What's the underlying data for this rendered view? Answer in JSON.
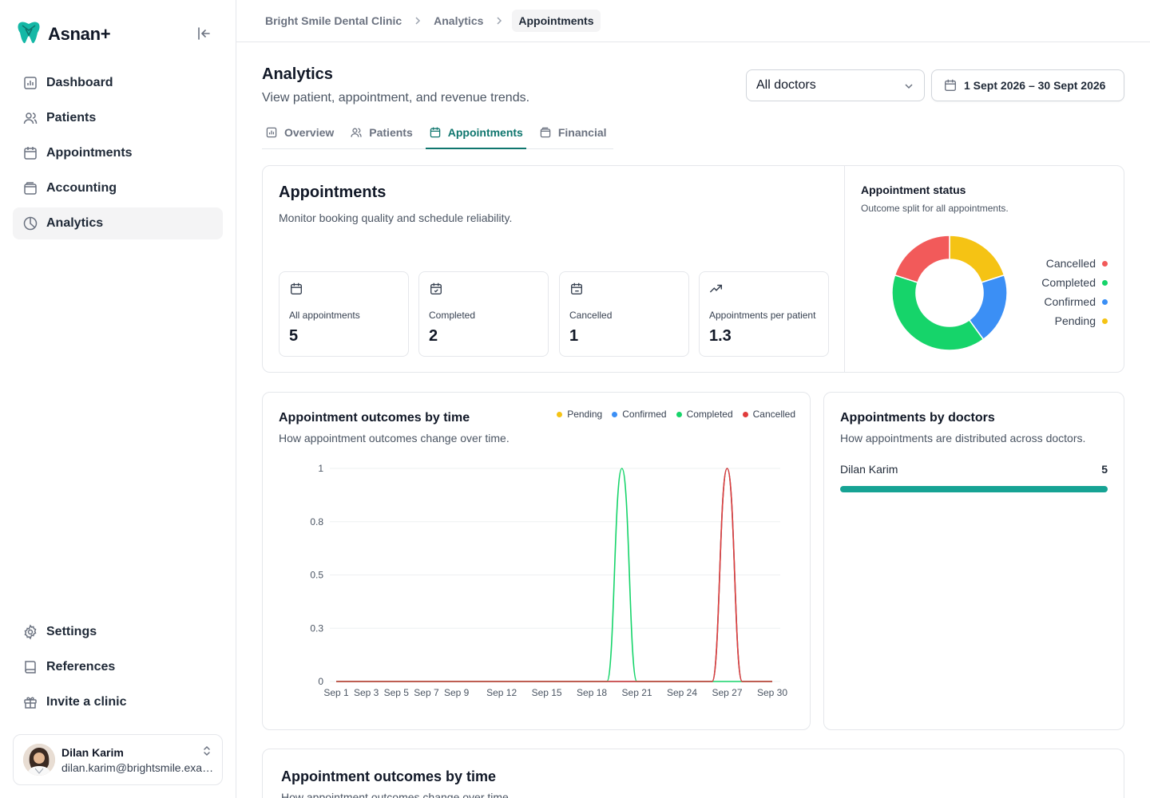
{
  "app": {
    "name": "Asnan+",
    "colors": {
      "accent": "#0f766e",
      "pending": "#f5c314",
      "confirmed": "#3b8ff5",
      "completed": "#16d46a",
      "cancelled": "#f25a5a",
      "bar": "#16a394"
    }
  },
  "sidebar": {
    "items": [
      {
        "label": "Dashboard",
        "icon": "bar-chart-icon"
      },
      {
        "label": "Patients",
        "icon": "users-icon"
      },
      {
        "label": "Appointments",
        "icon": "calendar-icon"
      },
      {
        "label": "Accounting",
        "icon": "wallet-icon"
      },
      {
        "label": "Analytics",
        "icon": "pie-chart-icon",
        "active": true
      }
    ],
    "bottom_items": [
      {
        "label": "Settings",
        "icon": "gear-icon"
      },
      {
        "label": "References",
        "icon": "book-icon"
      },
      {
        "label": "Invite a clinic",
        "icon": "gift-icon"
      }
    ],
    "user": {
      "name": "Dilan Karim",
      "email": "dilan.karim@brightsmile.example"
    }
  },
  "breadcrumb": [
    "Bright Smile Dental Clinic",
    "Analytics",
    "Appointments"
  ],
  "page": {
    "title": "Analytics",
    "subtitle": "View patient, appointment, and revenue trends.",
    "doctor_filter": "All doctors",
    "date_range": "1 Sept 2026 – 30 Sept 2026"
  },
  "tabs": [
    {
      "label": "Overview",
      "icon": "bar-chart-icon"
    },
    {
      "label": "Patients",
      "icon": "users-icon"
    },
    {
      "label": "Appointments",
      "icon": "calendar-icon",
      "active": true
    },
    {
      "label": "Financial",
      "icon": "wallet-icon"
    }
  ],
  "summary": {
    "title": "Appointments",
    "description": "Monitor booking quality and schedule reliability.",
    "kpis": [
      {
        "label": "All appointments",
        "value": "5",
        "icon": "calendar-icon"
      },
      {
        "label": "Completed",
        "value": "2",
        "icon": "calendar-check-icon"
      },
      {
        "label": "Cancelled",
        "value": "1",
        "icon": "calendar-minus-icon"
      },
      {
        "label": "Appointments per patient",
        "value": "1.3",
        "icon": "trending-up-icon"
      }
    ]
  },
  "status_card": {
    "title": "Appointment status",
    "description": "Outcome split for all appointments."
  },
  "outcomes_card": {
    "title": "Appointment outcomes by time",
    "description": "How appointment outcomes change over time."
  },
  "doctors_card": {
    "title": "Appointments by doctors",
    "description": "How appointments are distributed across doctors.",
    "rows": [
      {
        "name": "Dilan Karim",
        "value": "5",
        "share": 1.0
      }
    ]
  },
  "bottom_card": {
    "title": "Appointment outcomes by time",
    "description": "How appointment outcomes change over time."
  },
  "chart_data": [
    {
      "type": "pie",
      "title": "Appointment status",
      "categories": [
        "Cancelled",
        "Completed",
        "Confirmed",
        "Pending"
      ],
      "values": [
        1,
        2,
        1,
        1
      ],
      "colors": [
        "#f25a5a",
        "#16d46a",
        "#3b8ff5",
        "#f5c314"
      ],
      "donut": true,
      "legend": "right"
    },
    {
      "type": "line",
      "title": "Appointment outcomes by time",
      "x": [
        "Sep 1",
        "Sep 2",
        "Sep 3",
        "Sep 4",
        "Sep 5",
        "Sep 6",
        "Sep 7",
        "Sep 8",
        "Sep 9",
        "Sep 10",
        "Sep 11",
        "Sep 12",
        "Sep 13",
        "Sep 14",
        "Sep 15",
        "Sep 16",
        "Sep 17",
        "Sep 18",
        "Sep 19",
        "Sep 20",
        "Sep 21",
        "Sep 22",
        "Sep 23",
        "Sep 24",
        "Sep 25",
        "Sep 26",
        "Sep 27",
        "Sep 28",
        "Sep 29",
        "Sep 30"
      ],
      "x_tick_labels": [
        "Sep 1",
        "Sep 3",
        "Sep 5",
        "Sep 7",
        "Sep 9",
        "Sep 12",
        "Sep 15",
        "Sep 18",
        "Sep 21",
        "Sep 24",
        "Sep 27",
        "Sep 30"
      ],
      "y_tick_labels": [
        "0",
        "0.3",
        "0.5",
        "0.8",
        "1"
      ],
      "ylim": [
        0,
        1
      ],
      "grid": true,
      "legend": "top-right",
      "series": [
        {
          "name": "Pending",
          "color": "#f5c314",
          "values": [
            0,
            0,
            0,
            0,
            0,
            0,
            0,
            0,
            0,
            0,
            0,
            0,
            0,
            0,
            0,
            0,
            0,
            0,
            0,
            0,
            0,
            0,
            0,
            0,
            0,
            0,
            1,
            0,
            0,
            0
          ]
        },
        {
          "name": "Confirmed",
          "color": "#3b8ff5",
          "values": [
            0,
            0,
            0,
            0,
            0,
            0,
            0,
            0,
            0,
            0,
            0,
            0,
            0,
            0,
            0,
            0,
            0,
            0,
            0,
            0,
            0,
            0,
            0,
            0,
            0,
            0,
            1,
            0,
            0,
            0
          ]
        },
        {
          "name": "Completed",
          "color": "#16d46a",
          "values": [
            0,
            0,
            0,
            0,
            0,
            0,
            0,
            0,
            0,
            0,
            0,
            0,
            0,
            0,
            0,
            0,
            0,
            0,
            0,
            1,
            0,
            0,
            0,
            0,
            0,
            0,
            0,
            0,
            0,
            0
          ]
        },
        {
          "name": "Cancelled",
          "color": "#e03c3c",
          "values": [
            0,
            0,
            0,
            0,
            0,
            0,
            0,
            0,
            0,
            0,
            0,
            0,
            0,
            0,
            0,
            0,
            0,
            0,
            0,
            0,
            0,
            0,
            0,
            0,
            0,
            0,
            1,
            0,
            0,
            0
          ]
        }
      ]
    }
  ]
}
